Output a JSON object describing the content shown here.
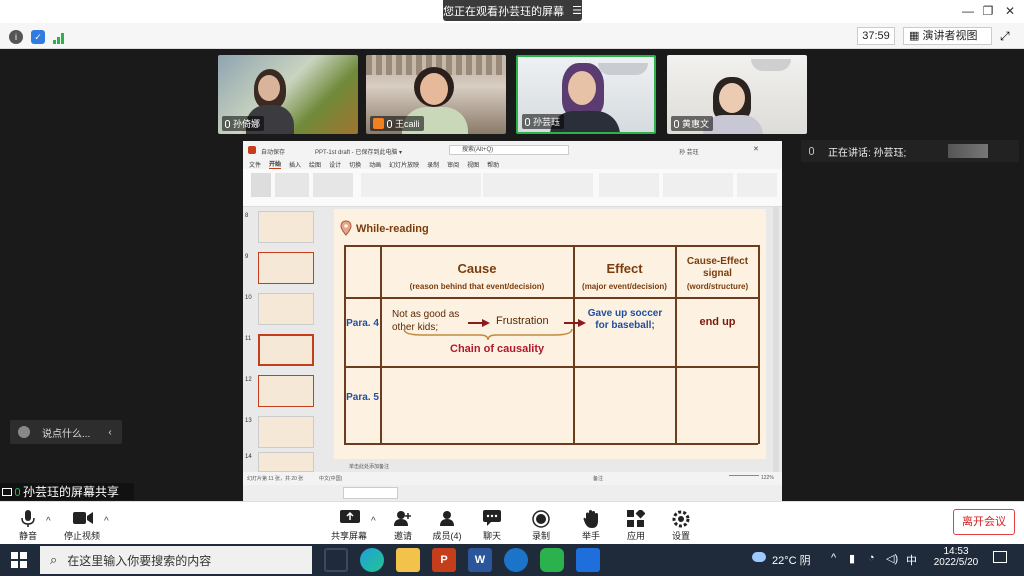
{
  "titlebar": {
    "banner_text": "您正在观看孙芸珏的屏幕",
    "banner_menu": "☰"
  },
  "toolbar": {
    "timer": "37:59",
    "view_mode": "演讲者视图",
    "view_chevron": "▾"
  },
  "participants": [
    {
      "name": "孙倚娜"
    },
    {
      "name": "王caili"
    },
    {
      "name": "孙芸珏"
    },
    {
      "name": "黄惠文"
    }
  ],
  "speaking": {
    "label": "正在讲话: 孙芸珏;"
  },
  "powerpoint": {
    "title": "PPT-1st draft - 已保存到此电脑 ▾",
    "search": "搜索(Alt+Q)",
    "user": "孙 芸珏",
    "menu": [
      "文件",
      "开始",
      "插入",
      "绘图",
      "设计",
      "切换",
      "动画",
      "幻灯片放映",
      "录制",
      "审阅",
      "视图",
      "帮助"
    ],
    "thumb_numbers": [
      "8",
      "9",
      "10",
      "11",
      "12",
      "13",
      "14"
    ],
    "status_left": "幻灯片第 11 张，共 20 张",
    "status_lang": "中文(中国)",
    "notes": "单击此处添加备注",
    "status_right": "备注",
    "zoom": "122%"
  },
  "slide": {
    "section_title": "While-reading",
    "headers": {
      "cause": "Cause",
      "cause_sub": "(reason behind that event/decision)",
      "effect": "Effect",
      "effect_sub": "(major event/decision)",
      "signal": "Cause-Effect signal",
      "signal_sub": "(word/structure)"
    },
    "rows": [
      {
        "para": "Para. 4",
        "cause_a": "Not as good as other kids;",
        "cause_b": "Frustration",
        "chain": "Chain of causality",
        "effect": "Gave up soccer for baseball;",
        "signal": "end up"
      },
      {
        "para": "Para. 5"
      }
    ]
  },
  "chat": {
    "placeholder": "说点什么...",
    "chevron": "‹"
  },
  "share_label": "孙芸珏的屏幕共享",
  "controls": {
    "mute": "静音",
    "stop_video": "停止视频",
    "share": "共享屏幕",
    "invite": "邀请",
    "members": "成员(4)",
    "chat": "聊天",
    "record": "录制",
    "raise": "举手",
    "apps": "应用",
    "settings": "设置",
    "leave": "离开会议"
  },
  "taskbar": {
    "search_placeholder": "在这里输入你要搜索的内容",
    "weather": "22°C 阴",
    "ime": "中",
    "time": "14:53",
    "date": "2022/5/20"
  },
  "colors": {
    "accent_green": "#2bb24c",
    "leave_red": "#d32020",
    "slide_brown": "#7b3d0c",
    "slide_blue": "#1f4fa0"
  }
}
